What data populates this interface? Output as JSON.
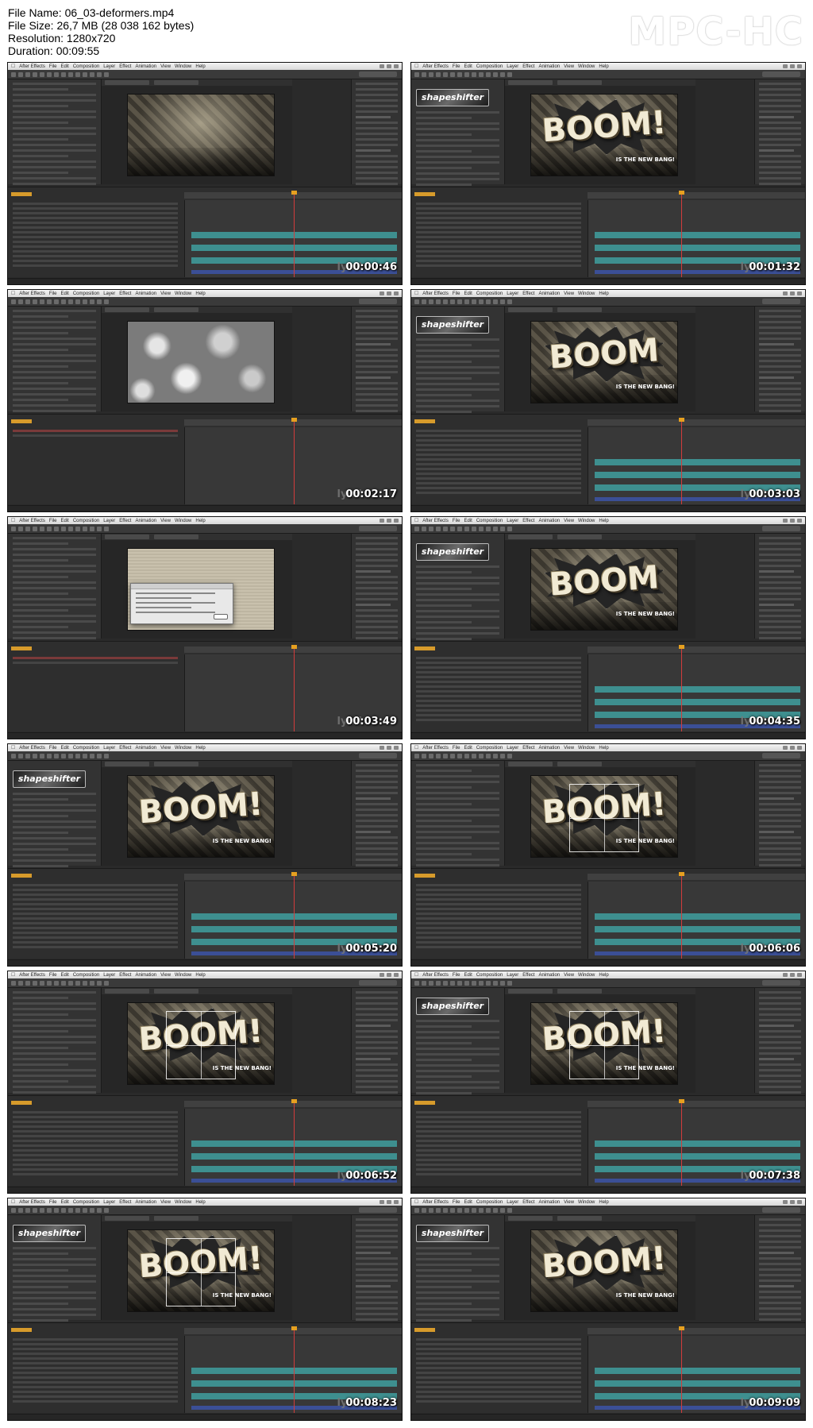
{
  "header": {
    "file_name": "File Name: 06_03-deformers.mp4",
    "file_size": "File Size: 26,7 MB (28 038 162 bytes)",
    "resolution": "Resolution: 1280x720",
    "duration": "Duration: 00:09:55",
    "brand": "MPC-HC"
  },
  "app_menu": [
    "After Effects",
    "File",
    "Edit",
    "Composition",
    "Layer",
    "Effect",
    "Animation",
    "View",
    "Window",
    "Help"
  ],
  "colors": {
    "timecode": "#d79b2b",
    "track_bar": "#3e8f8f",
    "playhead": "#d23c3c",
    "panel_bg": "#333333"
  },
  "frames": [
    {
      "timestamp": "00:00:46",
      "view": "empty-stage",
      "watermark": "lynd"
    },
    {
      "timestamp": "00:01:32",
      "view": "boom",
      "boom_text": "BOOM!",
      "tagline": "IS THE NEW BANG!",
      "logo": "shapeshifter",
      "watermark": "lynd"
    },
    {
      "timestamp": "00:02:17",
      "view": "noise",
      "watermark": "lynd"
    },
    {
      "timestamp": "00:03:03",
      "view": "boom",
      "boom_text": "BOOM",
      "tagline": "IS THE NEW BANG!",
      "logo": "shapeshifter",
      "watermark": "lynd"
    },
    {
      "timestamp": "00:03:49",
      "view": "dialog",
      "dialog_title": "After Effects",
      "watermark": "lynd"
    },
    {
      "timestamp": "00:04:35",
      "view": "boom",
      "boom_text": "BOOM",
      "tagline": "IS THE NEW BANG!",
      "logo": "shapeshifter",
      "watermark": "lynd"
    },
    {
      "timestamp": "00:05:20",
      "view": "boom",
      "boom_text": "BOOM!",
      "tagline": "IS THE NEW BANG!",
      "logo": "shapeshifter",
      "watermark": "lynd"
    },
    {
      "timestamp": "00:06:06",
      "view": "boom-cage",
      "boom_text": "BOOM!",
      "tagline": "IS THE NEW BANG!",
      "watermark": "lynd"
    },
    {
      "timestamp": "00:06:52",
      "view": "boom-cage",
      "boom_text": "BOOM!",
      "tagline": "IS THE NEW BANG!",
      "watermark": "lynd"
    },
    {
      "timestamp": "00:07:38",
      "view": "boom-cage",
      "boom_text": "BOOM!",
      "tagline": "IS THE NEW BANG!",
      "logo": "shapeshifter",
      "watermark": "lynd"
    },
    {
      "timestamp": "00:08:23",
      "view": "boom-cage",
      "boom_text": "BOOM!",
      "tagline": "IS THE NEW BANG!",
      "logo": "shapeshifter",
      "watermark": "lynd"
    },
    {
      "timestamp": "00:09:09",
      "view": "boom",
      "boom_text": "BOOM!",
      "tagline": "IS THE NEW BANG!",
      "logo": "shapeshifter",
      "watermark": "lynd"
    }
  ]
}
